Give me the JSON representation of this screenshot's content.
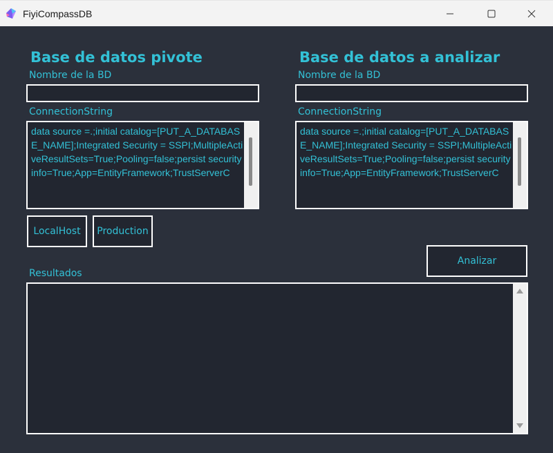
{
  "window": {
    "title": "FiyiCompassDB",
    "icon": "app-logo-icon",
    "controls": [
      "minimize-icon",
      "maximize-icon",
      "close-icon"
    ]
  },
  "pivot": {
    "heading": "Base de datos pivote",
    "name_label": "Nombre de la BD",
    "name_value": "",
    "conn_label": "ConnectionString",
    "conn_value": "data source =.;initial catalog=[PUT_A_DATABASE_NAME];Integrated Security = SSPI;MultipleActiveResultSets=True;Pooling=false;persist security info=True;App=EntityFramework;TrustServerC",
    "localhost_button": "LocalHost",
    "production_button": "Production"
  },
  "target": {
    "heading": "Base de datos a analizar",
    "name_label": "Nombre de la BD",
    "name_value": "",
    "conn_label": "ConnectionString",
    "conn_value": "data source =.;initial catalog=[PUT_A_DATABASE_NAME];Integrated Security = SSPI;MultipleActiveResultSets=True;Pooling=false;persist security info=True;App=EntityFramework;TrustServerC"
  },
  "analyze_button": "Analizar",
  "results": {
    "label": "Resultados",
    "value": ""
  },
  "colors": {
    "background": "#2b303b",
    "field_background": "#222630",
    "accent": "#33c1d6",
    "border": "#ffffff"
  }
}
